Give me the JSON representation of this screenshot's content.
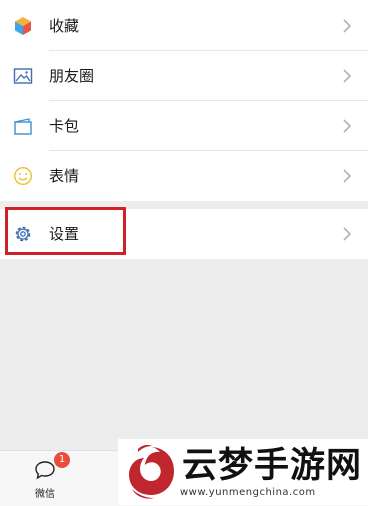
{
  "menu": {
    "items": [
      {
        "label": "收藏",
        "icon": "favorites-icon"
      },
      {
        "label": "朋友圈",
        "icon": "moments-icon"
      },
      {
        "label": "卡包",
        "icon": "cards-icon"
      },
      {
        "label": "表情",
        "icon": "stickers-icon"
      }
    ],
    "settings": {
      "label": "设置",
      "icon": "settings-icon"
    }
  },
  "tabbar": {
    "wechat_label": "微信",
    "wechat_badge": "1"
  },
  "watermark": {
    "title": "云梦手游网",
    "url": "www.yunmengchina.com"
  },
  "colors": {
    "highlight_border": "#d0202a",
    "badge": "#e84c3d",
    "watermark_red": "#c0262d"
  }
}
